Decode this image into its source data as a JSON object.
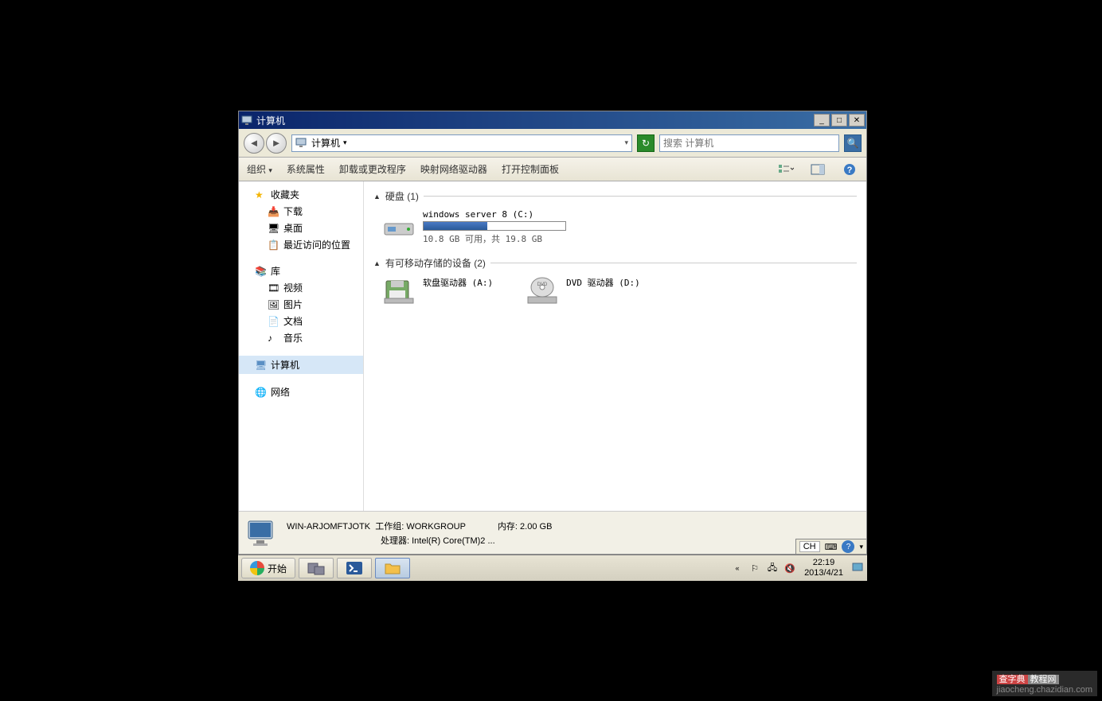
{
  "window": {
    "title": "计算机",
    "controls": {
      "minimize": "_",
      "maximize": "□",
      "close": "✕"
    }
  },
  "nav": {
    "breadcrumb": "计算机",
    "breadcrumb_drop": "▾",
    "search_placeholder": "搜索 计算机"
  },
  "toolbar": {
    "organize": "组织",
    "organize_drop": "▾",
    "properties": "系统属性",
    "uninstall": "卸载或更改程序",
    "map_drive": "映射网络驱动器",
    "control_panel": "打开控制面板"
  },
  "sidebar": {
    "favorites": {
      "label": "收藏夹"
    },
    "favorites_items": [
      {
        "label": "下载"
      },
      {
        "label": "桌面"
      },
      {
        "label": "最近访问的位置"
      }
    ],
    "libraries": {
      "label": "库"
    },
    "libraries_items": [
      {
        "label": "视频"
      },
      {
        "label": "图片"
      },
      {
        "label": "文档"
      },
      {
        "label": "音乐"
      }
    ],
    "computer": {
      "label": "计算机"
    },
    "network": {
      "label": "网络"
    }
  },
  "content": {
    "section_hdd": "硬盘 (1)",
    "hdd": {
      "name": "windows server 8 (C:)",
      "stats": "10.8 GB 可用，共 19.8 GB",
      "fill_percent": 45
    },
    "section_removable": "有可移动存储的设备 (2)",
    "floppy": {
      "name": "软盘驱动器 (A:)"
    },
    "dvd": {
      "name": "DVD 驱动器 (D:)"
    }
  },
  "details": {
    "computer_name": "WIN-ARJOMFTJOTK",
    "workgroup_label": "工作组:",
    "workgroup": "WORKGROUP",
    "memory_label": "内存:",
    "memory": "2.00 GB",
    "processor_label": "处理器:",
    "processor": "Intel(R) Core(TM)2 ..."
  },
  "langbar": {
    "ime": "CH"
  },
  "taskbar": {
    "start": "开始",
    "time": "22:19",
    "date": "2013/4/21"
  },
  "watermark": {
    "a": "查字典",
    "b": "教程网",
    "url": "jiaocheng.chazidian.com"
  }
}
